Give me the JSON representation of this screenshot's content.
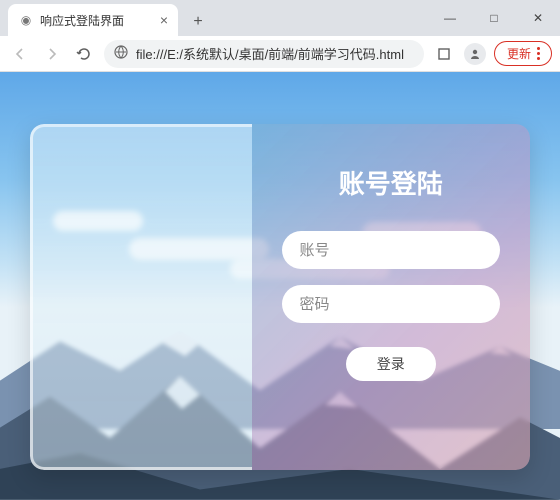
{
  "browser": {
    "tab_title": "响应式登陆界面",
    "new_tab_glyph": "+",
    "tab_close_glyph": "×",
    "win_min": "—",
    "win_max": "□",
    "win_close": "✕",
    "address": "file:///E:/系统默认/桌面/前端/前端学习代码.html",
    "update_label": "更新"
  },
  "login": {
    "title": "账号登陆",
    "username_placeholder": "账号",
    "password_placeholder": "密码",
    "submit_label": "登录"
  }
}
